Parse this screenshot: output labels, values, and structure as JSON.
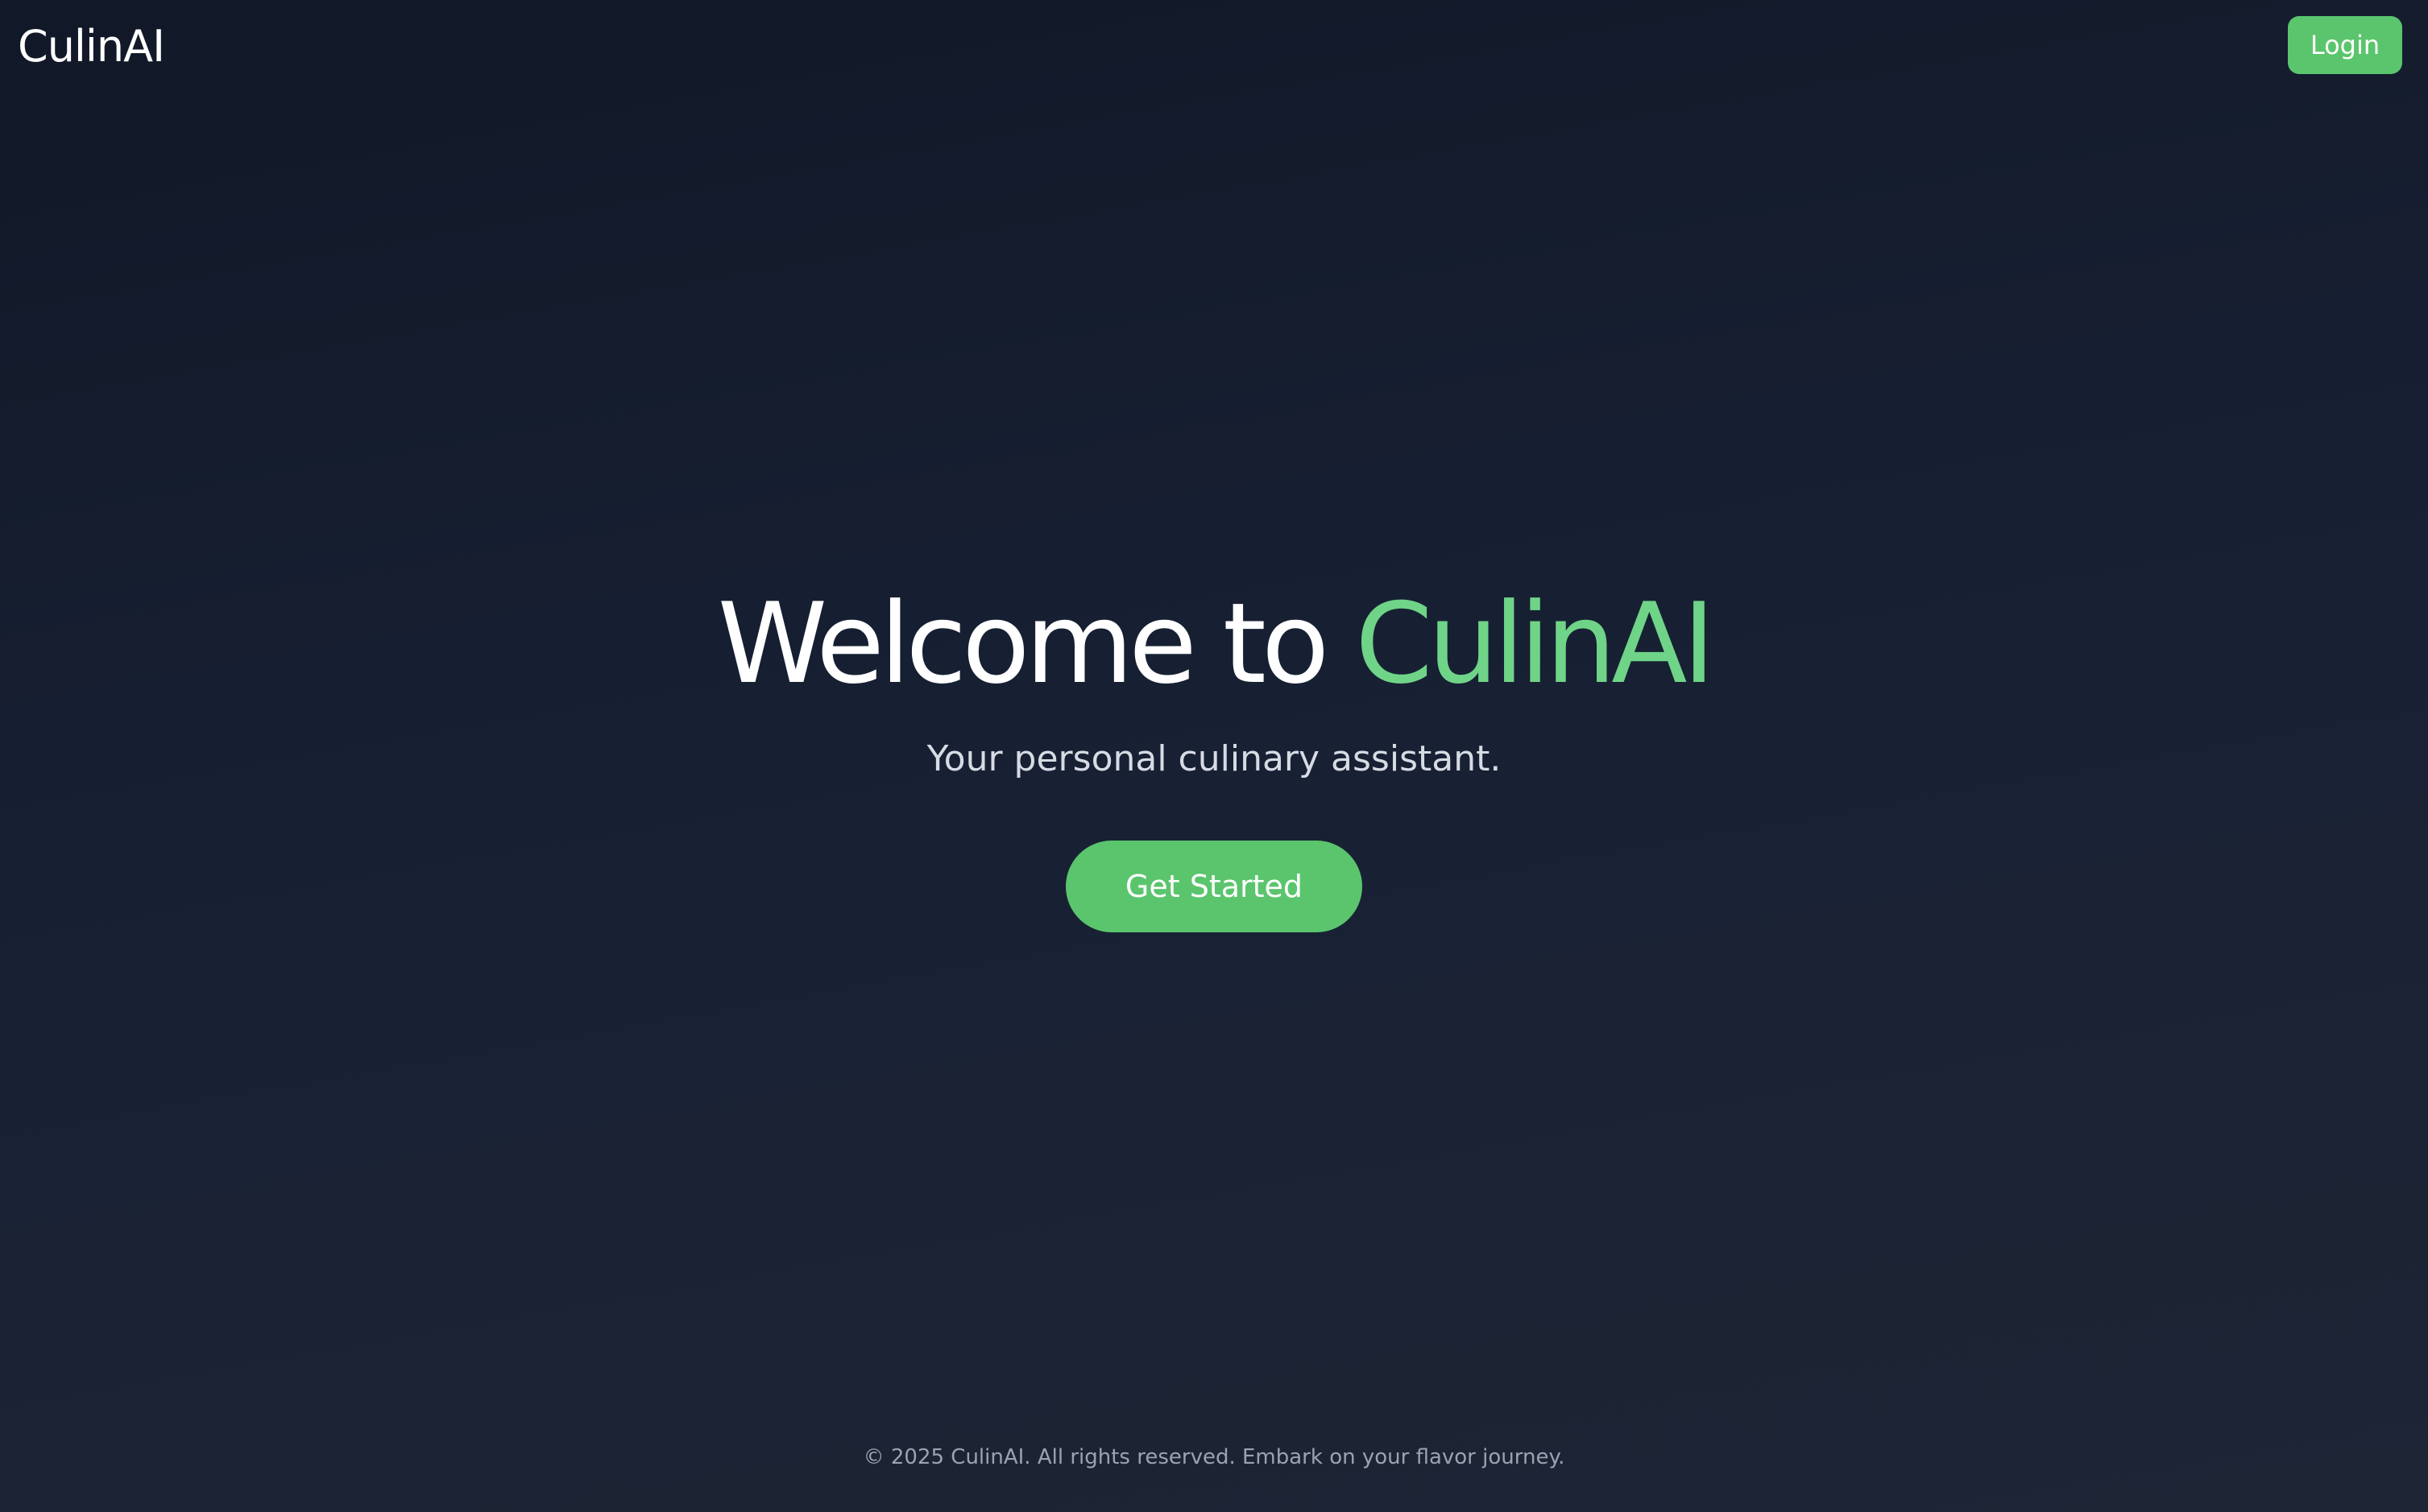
{
  "header": {
    "logo": "CulinAI",
    "login_label": "Login"
  },
  "hero": {
    "title_prefix": "Welcome to ",
    "title_brand": "CulinAI",
    "subtitle": "Your personal culinary assistant.",
    "cta_label": "Get Started"
  },
  "footer": {
    "text": "© 2025 CulinAI. All rights reserved. Embark on your flavor journey."
  },
  "colors": {
    "accent": "#5ac56d",
    "brand_text": "#6fd487",
    "background_top": "#111827",
    "background_bottom": "#1e2535"
  }
}
